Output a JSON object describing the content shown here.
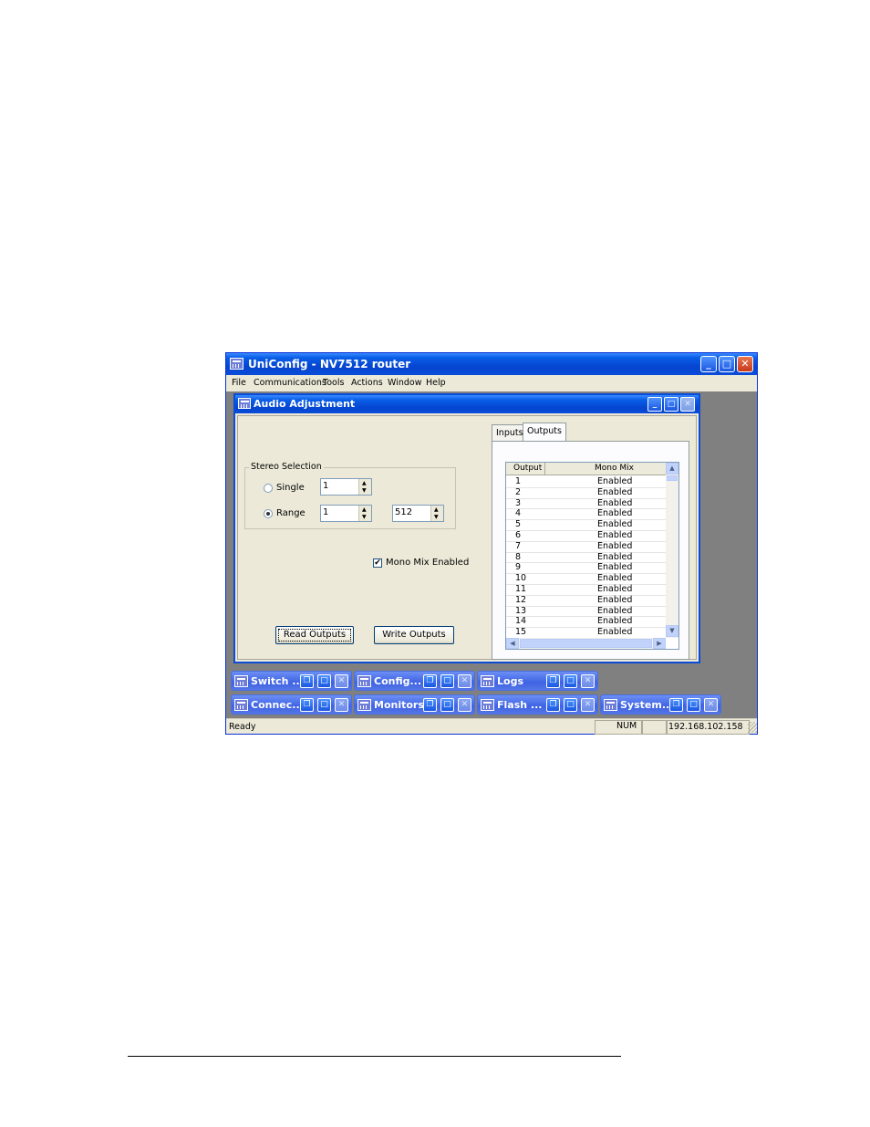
{
  "app": {
    "title": "UniConfig - NV7512 router",
    "menu": [
      "File",
      "Communications",
      "Tools",
      "Actions",
      "Window",
      "Help"
    ]
  },
  "child": {
    "title": "Audio Adjustment",
    "stereo_group_label": "Stereo Selection",
    "single_label": "Single",
    "range_label": "Range",
    "single_value": "1",
    "range_from": "1",
    "range_to": "512",
    "selected_mode": "Range",
    "mono_mix_label": "Mono Mix Enabled",
    "mono_mix_checked": true,
    "read_button": "Read Outputs",
    "write_button": "Write Outputs",
    "tabs": [
      "Inputs",
      "Outputs"
    ],
    "selected_tab": "Outputs",
    "list_headers": [
      "Output",
      "Mono Mix"
    ],
    "rows": [
      {
        "output": "1",
        "mono_mix": "Enabled"
      },
      {
        "output": "2",
        "mono_mix": "Enabled"
      },
      {
        "output": "3",
        "mono_mix": "Enabled"
      },
      {
        "output": "4",
        "mono_mix": "Enabled"
      },
      {
        "output": "5",
        "mono_mix": "Enabled"
      },
      {
        "output": "6",
        "mono_mix": "Enabled"
      },
      {
        "output": "7",
        "mono_mix": "Enabled"
      },
      {
        "output": "8",
        "mono_mix": "Enabled"
      },
      {
        "output": "9",
        "mono_mix": "Enabled"
      },
      {
        "output": "10",
        "mono_mix": "Enabled"
      },
      {
        "output": "11",
        "mono_mix": "Enabled"
      },
      {
        "output": "12",
        "mono_mix": "Enabled"
      },
      {
        "output": "13",
        "mono_mix": "Enabled"
      },
      {
        "output": "14",
        "mono_mix": "Enabled"
      },
      {
        "output": "15",
        "mono_mix": "Enabled"
      }
    ]
  },
  "minimized_windows": [
    {
      "label": "Switch ..."
    },
    {
      "label": "Config..."
    },
    {
      "label": "Logs"
    },
    {
      "label": "Connec..."
    },
    {
      "label": "Monitors"
    },
    {
      "label": "Flash ..."
    },
    {
      "label": "System..."
    }
  ],
  "status": {
    "text": "Ready",
    "num": "NUM",
    "ip": "192.168.102.158"
  },
  "colors": {
    "titlebar": "#0a4cd8",
    "face": "#ece9d8",
    "mdi_background": "#808080"
  }
}
